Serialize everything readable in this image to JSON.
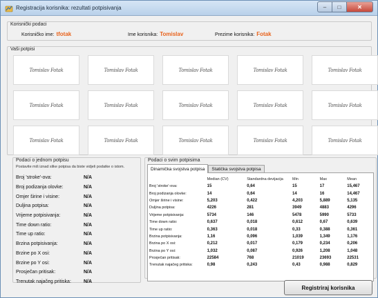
{
  "window": {
    "title": "Registracija korisnika: rezultati potpisivanja",
    "min": "–",
    "max": "□",
    "close": "✕"
  },
  "user_group": {
    "title": "Korisnički podaci",
    "username_label": "Korisničko ime:",
    "username": "tfotak",
    "firstname_label": "Ime korisnika:",
    "firstname": "Tomislav",
    "lastname_label": "Prezime korisnika:",
    "lastname": "Fotak"
  },
  "signatures_group": {
    "title": "Vaši potpisi",
    "items": [
      "Tomislav Fotak",
      "Tomislav Fotak",
      "Tomislav Fotak",
      "Tomislav Fotak",
      "Tomislav Fotak",
      "Tomislav Fotak",
      "Tomislav Fotak",
      "Tomislav Fotak",
      "Tomislav Fotak",
      "Tomislav Fotak",
      "Tomislav Fotak",
      "Tomislav Fotak",
      "Tomislav Fotak",
      "Tomislav Fotak",
      "Tomislav Fotak"
    ]
  },
  "single_group": {
    "title": "Podaci o jednom potpisu",
    "hint": "Postavite miš iznad slike potpisa da biste vidjeli podatke o istom.",
    "rows": [
      {
        "label": "Broj 'stroke'-ova:",
        "value": "N/A"
      },
      {
        "label": "Broj podizanja olovke:",
        "value": "N/A"
      },
      {
        "label": "Omjer širine i visine:",
        "value": "N/A"
      },
      {
        "label": "Duljina potpisa:",
        "value": "N/A"
      },
      {
        "label": "Vrijeme potpisivanja:",
        "value": "N/A"
      },
      {
        "label": "Time down ratio:",
        "value": "N/A"
      },
      {
        "label": "Time up ratio:",
        "value": "N/A"
      },
      {
        "label": "Brzina potpisivanja:",
        "value": "N/A"
      },
      {
        "label": "Brzine po X osi:",
        "value": "N/A"
      },
      {
        "label": "Brzine po Y osi:",
        "value": "N/A"
      },
      {
        "label": "Prosječan pritisak:",
        "value": "N/A"
      },
      {
        "label": "Trenutak najačeg pritiska:",
        "value": "N/A"
      }
    ]
  },
  "all_group": {
    "title": "Podaci o svim potpisima",
    "tabs": [
      "Dinamička svojstva potpisa",
      "Statička svojstva potpisa"
    ],
    "columns": [
      "",
      "Median (CV)",
      "Standardna devijacija",
      "Min",
      "Max",
      "Mean"
    ],
    "rows": [
      [
        "Broj 'stroke'-ova:",
        "15",
        "0,64",
        "15",
        "17",
        "15,467"
      ],
      [
        "Broj podizanja olovke:",
        "14",
        "0,64",
        "14",
        "16",
        "14,467"
      ],
      [
        "Omjer širine i visine:",
        "5,203",
        "0,422",
        "4,203",
        "5,889",
        "5,135"
      ],
      [
        "Duljina potpisa:",
        "4226",
        "281",
        "3949",
        "4883",
        "4296"
      ],
      [
        "Vrijeme potpisivanja:",
        "5734",
        "146",
        "5478",
        "5990",
        "5733"
      ],
      [
        "Time down ratio:",
        "0,637",
        "0,018",
        "0,612",
        "0,67",
        "0,639"
      ],
      [
        "Time up ratio:",
        "0,363",
        "0,018",
        "0,33",
        "0,388",
        "0,361"
      ],
      [
        "Brzina potpisivanja:",
        "1,16",
        "0,096",
        "1,039",
        "1,349",
        "1,176"
      ],
      [
        "Brzina po X osi:",
        "0,212",
        "0,017",
        "0,179",
        "0,234",
        "0,206"
      ],
      [
        "Brzina po Y osi:",
        "1,032",
        "0,087",
        "0,926",
        "1,208",
        "1,048"
      ],
      [
        "Prosječan pritisak:",
        "22584",
        "768",
        "21019",
        "23693",
        "22531"
      ],
      [
        "Trenutak najačeg pritiska:",
        "0,98",
        "0,243",
        "0,43",
        "0,988",
        "0,829"
      ]
    ]
  },
  "register_button": "Registriraj korisnika",
  "colors": {
    "accent_value": "#e8621b"
  }
}
